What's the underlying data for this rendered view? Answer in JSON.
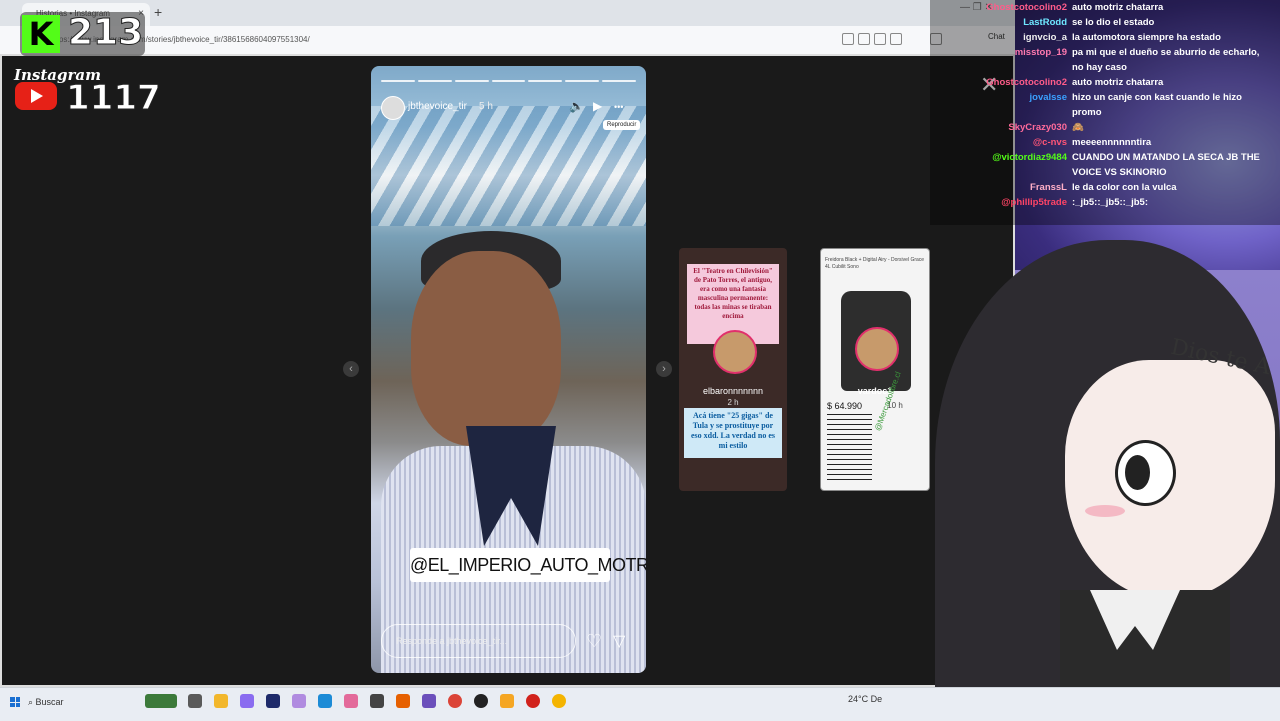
{
  "browser": {
    "tab_title": "Historias • Instagram",
    "tab_close": "×",
    "new_tab": "+",
    "url": "https://www.instagram.com/stories/jbthevoice_tir/3861568604097551304/",
    "chat_label": "Chat",
    "window_controls": "—  ❐  ✕"
  },
  "overlay": {
    "kick_logo": "K",
    "kick_count": "213",
    "instagram_label": "Instagram",
    "youtube_count": "1117"
  },
  "story": {
    "username": "jbthevoice_tir",
    "time": "5 h",
    "volume_icon": "🔈",
    "play_icon": "▶",
    "more_icon": "•••",
    "tooltip": "Reproducir",
    "mention_tag": "@EL_IMPERIO_AUTO_MOTRIZ",
    "reply_placeholder": "Responde a jbthevoice_tir...",
    "heart_icon": "♡",
    "send_icon": "▽",
    "close_icon": "✕",
    "prev_arrow": "‹",
    "next_arrow": "›"
  },
  "preview1": {
    "headline": "El \"Teatro en Chilevisión\" de Pato Torres, el antiguo, era como una fantasía masculina permanente: todas las minas se tiraban encima",
    "username": "elbaronnnnnnn",
    "time": "2 h",
    "caption": "Acá tiene \"25 gigas\" de Tula y se prostituye por eso xdd. La verdad no es mi estilo"
  },
  "preview2": {
    "header": "Freidora Black + Digital Airy - Dorsivel Grace 4L Cubilit Sono",
    "username": "vardoc1",
    "time": "10 h",
    "price": "$ 64.990",
    "watermark": "@Mercadolibre.cl"
  },
  "chat": [
    {
      "user": "Ghostcotocolino2",
      "text": "auto motriz chatarra",
      "color": "#ff5c8a"
    },
    {
      "user": "LastRodd",
      "text": "se lo dio el estado",
      "color": "#6ee7ff"
    },
    {
      "user": "ignvcio_a",
      "text": "la automotora siempre ha estado",
      "color": "#f0f0f0"
    },
    {
      "user": "misstop_19",
      "text": "pa mi que el dueño se aburrio de echarlo, no hay caso",
      "color": "#ff7ab0"
    },
    {
      "user": "Ghostcotocolino2",
      "text": "auto motriz chatarra",
      "color": "#ff5c8a"
    },
    {
      "user": "jovalsse",
      "text": "hizo un canje con kast cuando le hizo promo",
      "color": "#3aa0ff"
    },
    {
      "user": "SkyCrazy030",
      "text": "🙈",
      "color": "#ff6a9a"
    },
    {
      "user": "@c-nvs",
      "text": "meeeennnnnntira",
      "color": "#ff5577"
    },
    {
      "user": "@victordiaz9484",
      "text": "CUANDO UN MATANDO LA SECA JB THE VOICE VS SKINORIO",
      "color": "#53fc18"
    },
    {
      "user": "FranssL",
      "text": "le da color con la vulca",
      "color": "#ffb0c8"
    },
    {
      "user": "@phillip5trade",
      "text": ":_jb5::_jb5::_jb5:",
      "color": "#ff4466"
    }
  ],
  "character": {
    "head_text": "Dios te A"
  },
  "taskbar": {
    "search_label": "Buscar",
    "weather": "24°C  De"
  }
}
